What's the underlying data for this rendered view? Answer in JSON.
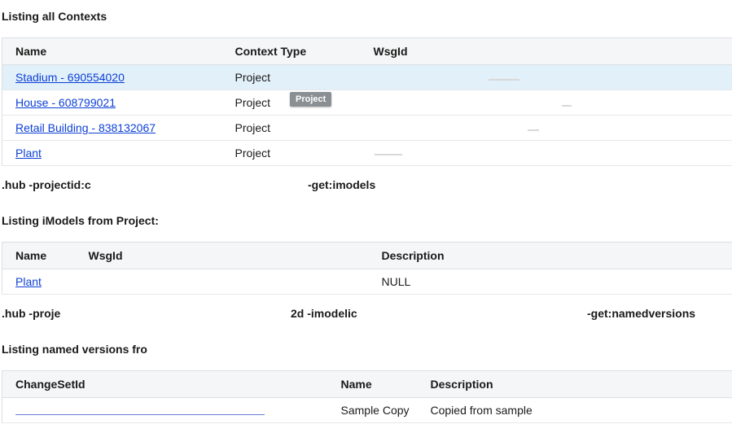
{
  "contexts": {
    "title": "Listing all Contexts",
    "columns": [
      "Name",
      "Context Type",
      "WsgId"
    ],
    "rows": [
      {
        "name": "Stadium - 690554020",
        "type": "Project"
      },
      {
        "name": "House - 608799021",
        "type": "Project"
      },
      {
        "name": "Retail Building - 838132067",
        "type": "Project"
      },
      {
        "name": "Plant",
        "type": "Project"
      }
    ],
    "tooltip": "Project"
  },
  "command1": {
    "prefix": ".hub -projectid:c",
    "suffix": "-get:imodels"
  },
  "imodels": {
    "title": "Listing iModels from Project:",
    "columns": [
      "Name",
      "WsgId",
      "Description"
    ],
    "rows": [
      {
        "name": "Plant",
        "description": "NULL"
      }
    ]
  },
  "command2": {
    "prefix": ".hub -proje",
    "middle": "2d -imodelic",
    "suffix": "-get:namedversions"
  },
  "versions": {
    "title": "Listing named versions fro",
    "columns": [
      "ChangeSetId",
      "Name",
      "Description"
    ],
    "rows": [
      {
        "name": "Sample Copy",
        "description": "Copied from sample"
      }
    ]
  }
}
